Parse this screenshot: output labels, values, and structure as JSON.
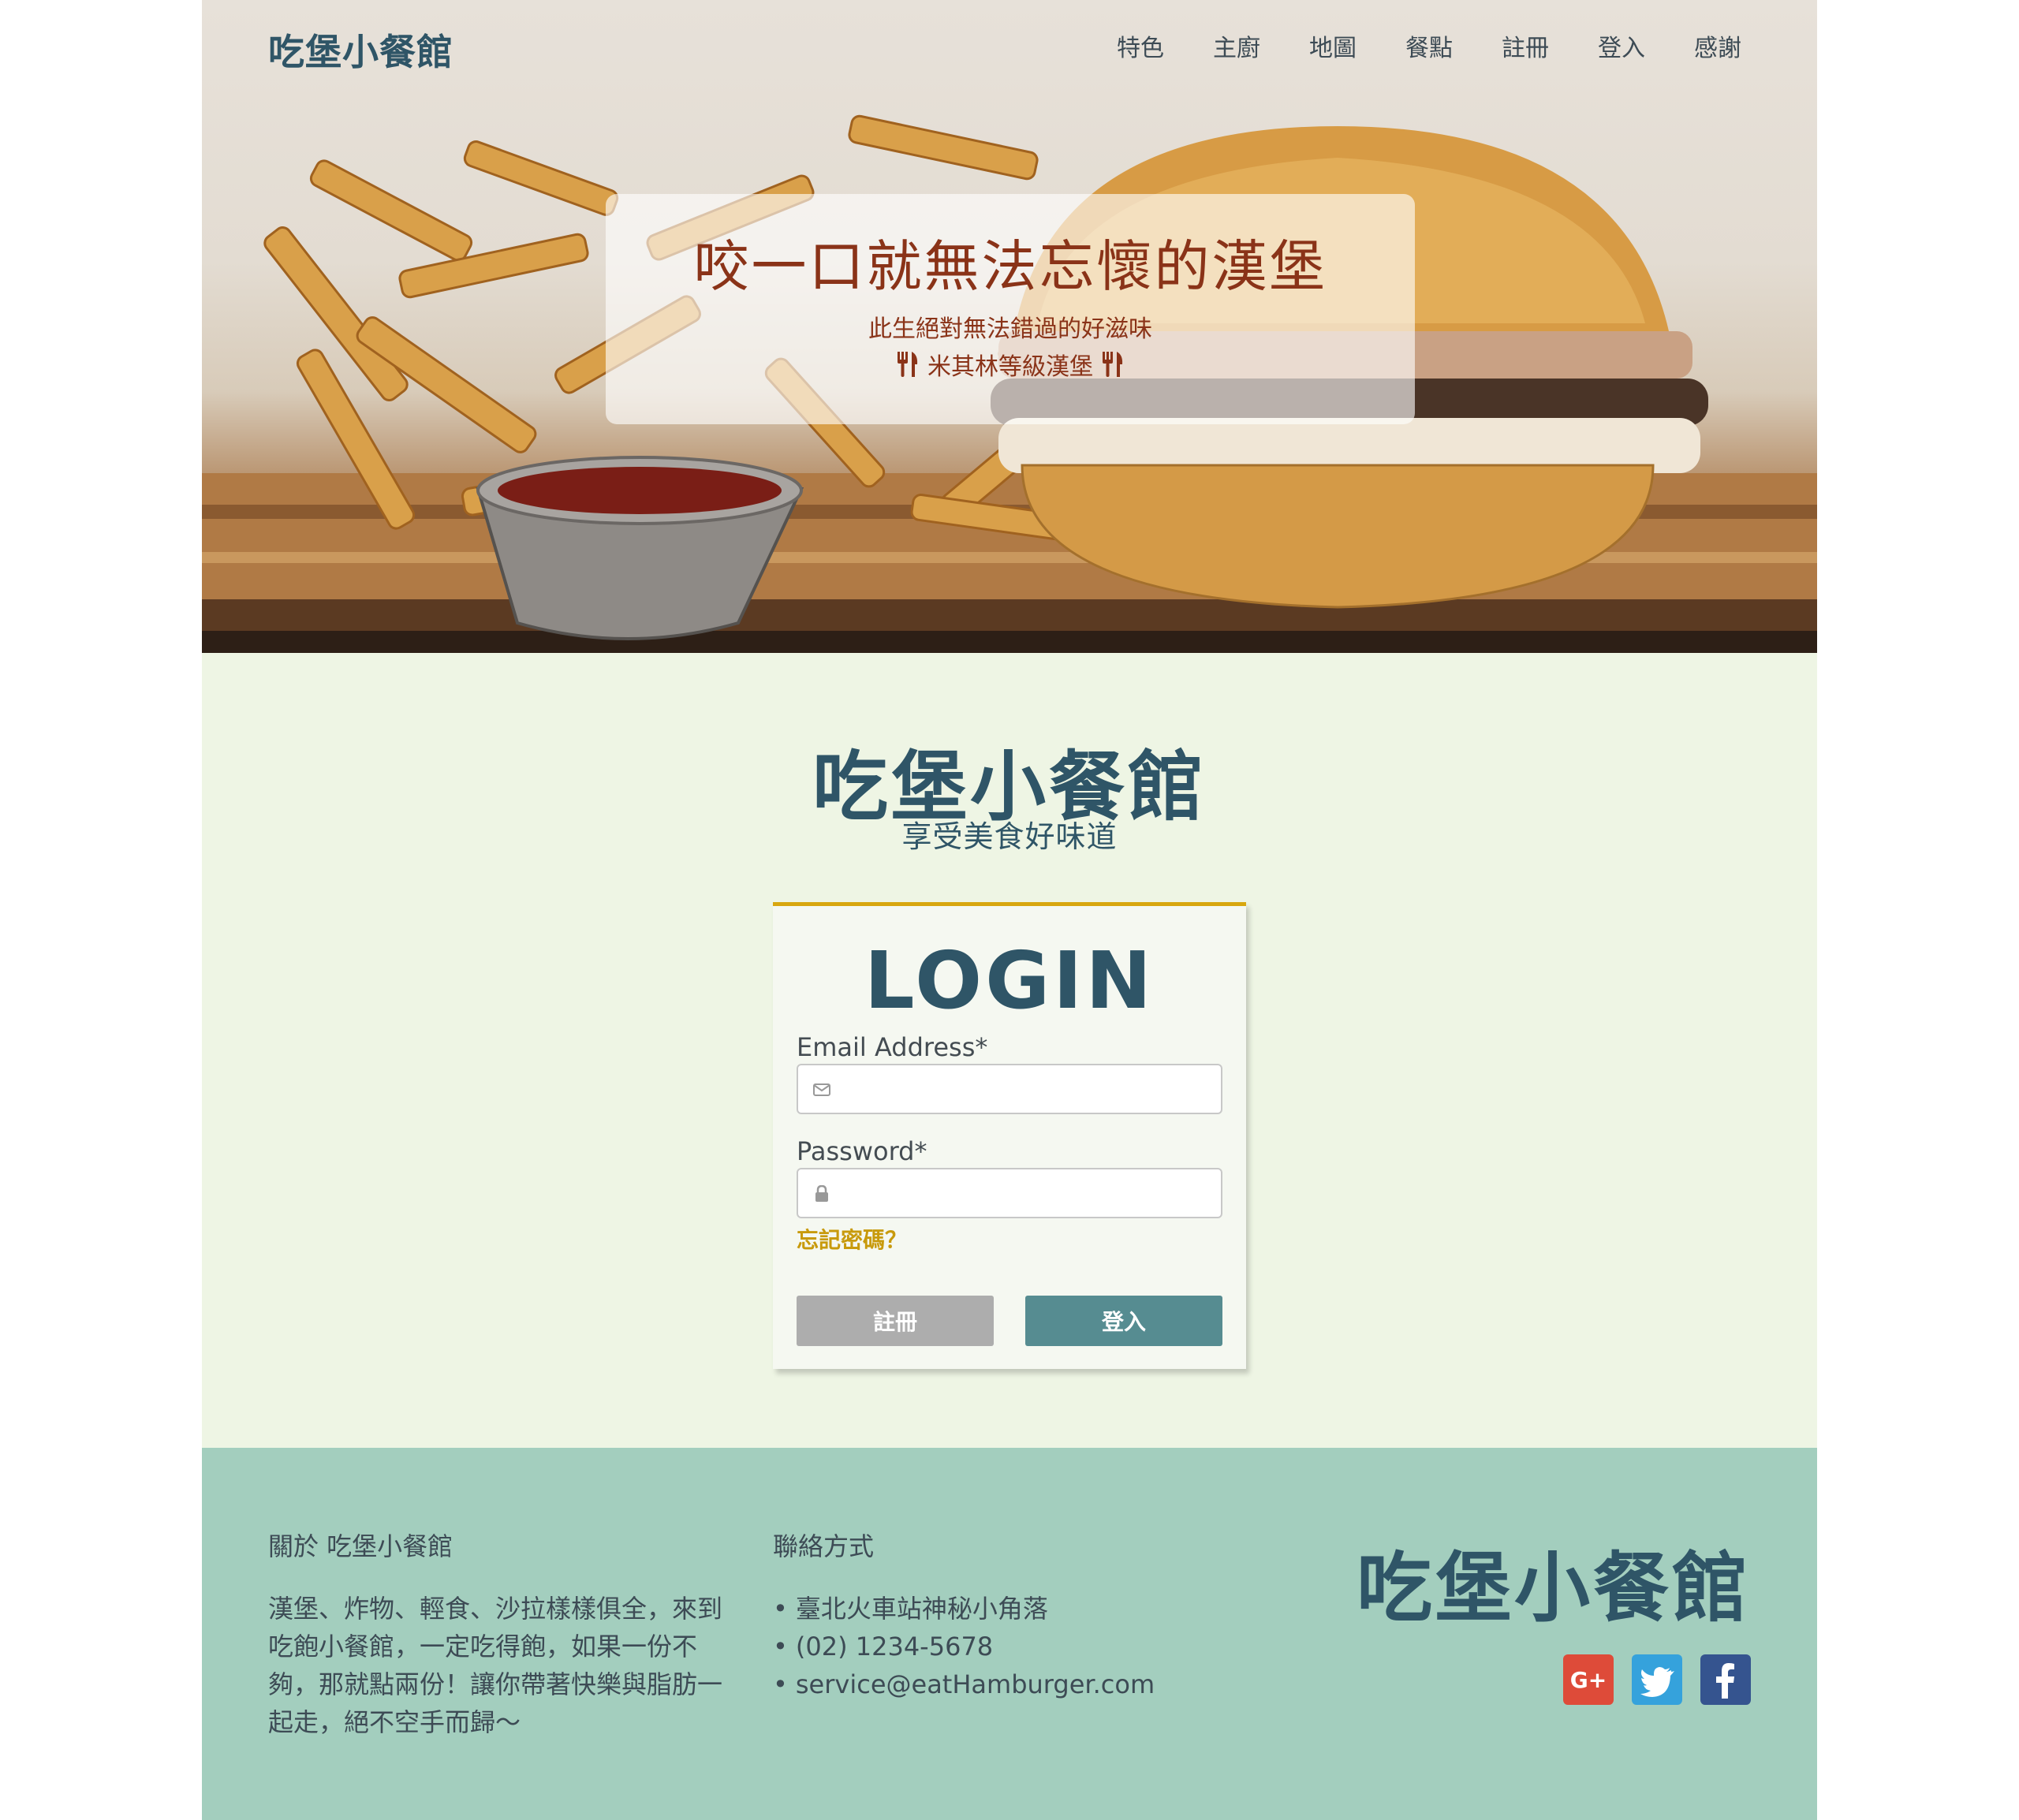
{
  "nav": {
    "brand": "吃堡小餐館",
    "links": [
      "特色",
      "主廚",
      "地圖",
      "餐點",
      "註冊",
      "登入",
      "感謝"
    ]
  },
  "hero": {
    "title": "咬一口就無法忘懷的漢堡",
    "subtitle": "此生絕對無法錯過的好滋味",
    "tagline": "米其林等級漢堡"
  },
  "main": {
    "brand": "吃堡小餐館",
    "tagline": "享受美食好味道"
  },
  "login": {
    "title": "LOGIN",
    "email_label": "Email Address*",
    "email_value": "",
    "password_label": "Password*",
    "password_value": "",
    "forgot": "忘記密碼？",
    "register_button": "註冊",
    "login_button": "登入"
  },
  "footer": {
    "about_heading": "關於 吃堡小餐館",
    "about_text": "漢堡、炸物、輕食、沙拉樣樣俱全，來到吃飽小餐館，一定吃得飽，如果一份不夠，那就點兩份！讓你帶著快樂與脂肪一起走，絕不空手而歸～",
    "contact_heading": "聯絡方式",
    "contacts": [
      "臺北火車站神秘小角落",
      "(02) 1234-5678",
      "service@eatHamburger.com"
    ],
    "brand": "吃堡小餐館",
    "social": {
      "google_label": "G+",
      "google_icon": "google-plus-icon",
      "twitter_icon": "twitter-icon",
      "facebook_icon": "facebook-icon"
    }
  },
  "colors": {
    "brand": "#2f5567",
    "accent": "#d8a70f",
    "hero_text": "#8a3318",
    "login_button": "#568c91",
    "register_button": "#adadad",
    "footer_bg": "#a3cebe",
    "main_bg": "#eef5e4"
  }
}
